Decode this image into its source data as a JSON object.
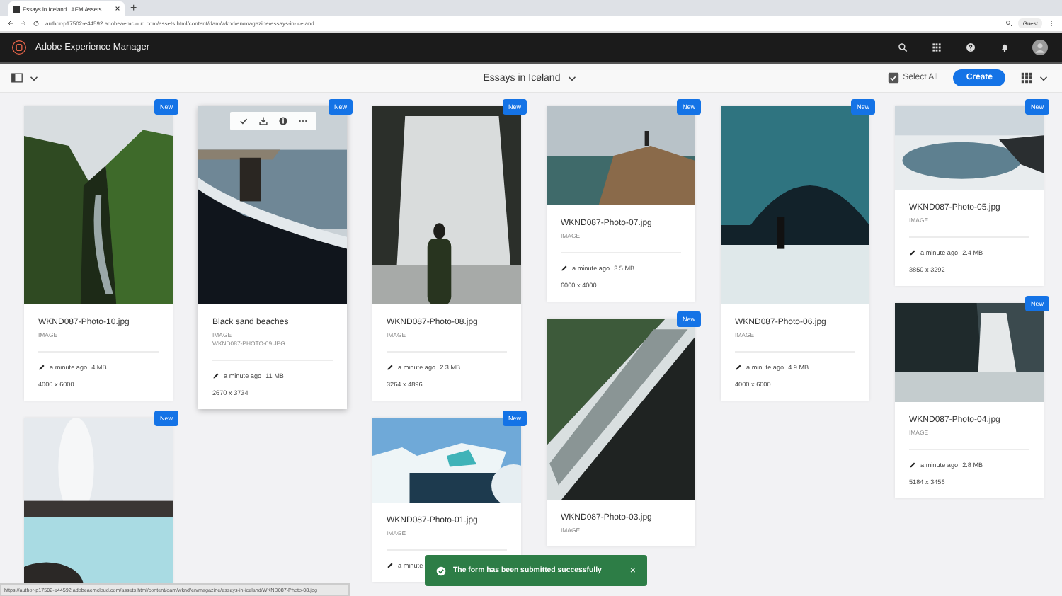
{
  "browser": {
    "tab_title": "Essays in Iceland | AEM Assets",
    "new_tab": "+",
    "url": "author-p17502-e44592.adobeaemcloud.com/assets.html/content/dam/wknd/en/magazine/essays-in-iceland",
    "profile": "Guest"
  },
  "header": {
    "product": "Adobe Experience Manager"
  },
  "toolbar": {
    "title": "Essays in Iceland",
    "select_all": "Select All",
    "create": "Create"
  },
  "columns": [
    {
      "cards": [
        {
          "badge": "New",
          "hovered": false,
          "title": "WKND087-Photo-10.jpg",
          "type": "IMAGE",
          "modified": "a minute ago",
          "size": "4 MB",
          "dimensions": "4000 x 6000"
        },
        {
          "badge": "New",
          "hovered": false
        }
      ]
    },
    {
      "cards": [
        {
          "badge": "New",
          "hovered": true,
          "title": "Black sand beaches",
          "type": "IMAGE",
          "filename": "WKND087-PHOTO-09.JPG",
          "modified": "a minute ago",
          "size": "11 MB",
          "dimensions": "2670 x 3734"
        }
      ]
    },
    {
      "cards": [
        {
          "badge": "New",
          "hovered": false,
          "title": "WKND087-Photo-08.jpg",
          "type": "IMAGE",
          "modified": "a minute ago",
          "size": "2.3 MB",
          "dimensions": "3264 x 4896"
        },
        {
          "badge": "New",
          "hovered": false,
          "title": "WKND087-Photo-01.jpg",
          "type": "IMAGE",
          "modified": "a minute"
        }
      ]
    },
    {
      "cards": [
        {
          "badge": "New",
          "hovered": false,
          "title": "WKND087-Photo-07.jpg",
          "type": "IMAGE",
          "modified": "a minute ago",
          "size": "3.5 MB",
          "dimensions": "6000 x 4000"
        },
        {
          "badge": "New",
          "hovered": false,
          "title": "WKND087-Photo-03.jpg",
          "type": "IMAGE"
        }
      ]
    },
    {
      "cards": [
        {
          "badge": "New",
          "hovered": false,
          "title": "WKND087-Photo-06.jpg",
          "type": "IMAGE",
          "modified": "a minute ago",
          "size": "4.9 MB",
          "dimensions": "4000 x 6000"
        }
      ]
    },
    {
      "cards": [
        {
          "badge": "New",
          "hovered": false,
          "title": "WKND087-Photo-05.jpg",
          "type": "IMAGE",
          "modified": "a minute ago",
          "size": "2.4 MB",
          "dimensions": "3850 x 3292"
        },
        {
          "badge": "New",
          "hovered": false,
          "title": "WKND087-Photo-04.jpg",
          "type": "IMAGE",
          "modified": "a minute ago",
          "size": "2.8 MB",
          "dimensions": "5184 x 3456"
        }
      ]
    }
  ],
  "toast": {
    "message": "The form has been submitted successfully",
    "close": "×"
  },
  "status_url": "https://author-p17502-e44592.adobeaemcloud.com/assets.html/content/dam/wknd/en/magazine/essays-in-iceland/WKND087-Photo-08.jpg"
}
